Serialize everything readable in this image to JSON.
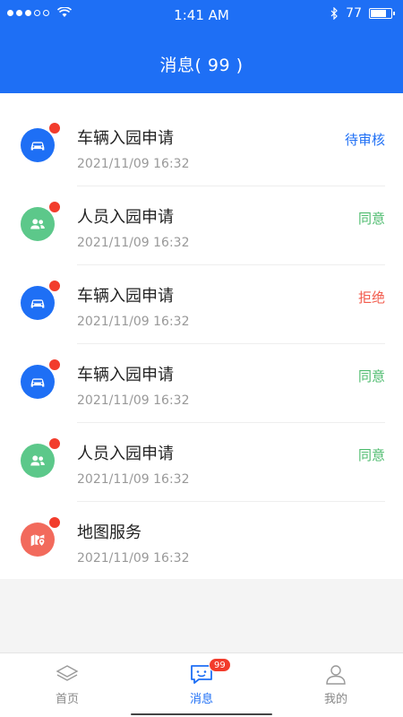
{
  "status_bar": {
    "time": "1:41 AM",
    "battery": "77"
  },
  "header": {
    "title": "消息( 99 )"
  },
  "messages": [
    {
      "title": "车辆入园申请",
      "time": "2021/11/09 16:32",
      "status": "待审核",
      "icon": "car-icon",
      "color": "#1e6ff5"
    },
    {
      "title": "人员入园申请",
      "time": "2021/11/09 16:32",
      "status": "同意",
      "icon": "people-icon",
      "color": "#5cc88a"
    },
    {
      "title": "车辆入园申请",
      "time": "2021/11/09 16:32",
      "status": "拒绝",
      "icon": "car-icon",
      "color": "#1e6ff5"
    },
    {
      "title": "车辆入园申请",
      "time": "2021/11/09 16:32",
      "status": "同意",
      "icon": "car-icon",
      "color": "#1e6ff5"
    },
    {
      "title": "人员入园申请",
      "time": "2021/11/09 16:32",
      "status": "同意",
      "icon": "people-icon",
      "color": "#5cc88a"
    },
    {
      "title": "地图服务",
      "time": "2021/11/09 16:32",
      "status": "",
      "icon": "map-icon",
      "color": "#f26a5c"
    }
  ],
  "tabbar": {
    "tabs": [
      {
        "label": "首页",
        "icon": "home-icon"
      },
      {
        "label": "消息",
        "icon": "message-icon",
        "badge": "99"
      },
      {
        "label": "我的",
        "icon": "profile-icon"
      }
    ]
  },
  "colors": {
    "primary": "#1e6ff5",
    "agree": "#4cbb6d",
    "reject": "#f25a4b",
    "unread_dot": "#f23c2c"
  }
}
